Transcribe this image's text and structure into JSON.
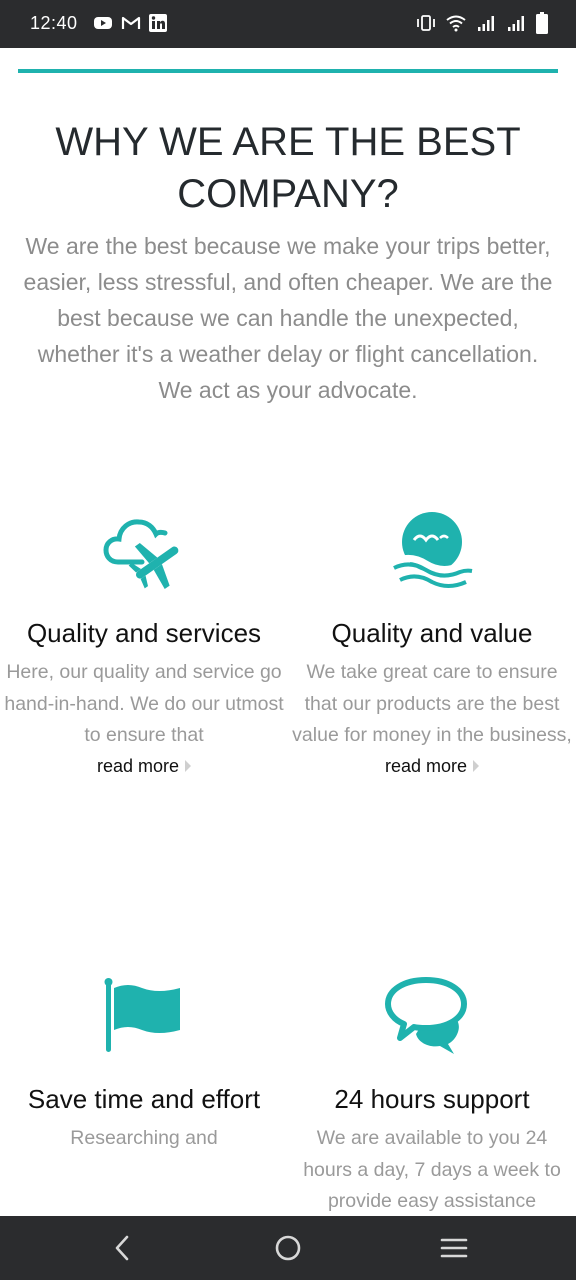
{
  "status": {
    "time": "12:40",
    "left_icons": [
      "youtube-icon",
      "gmail-icon",
      "linkedin-icon"
    ],
    "right_icons": [
      "vibrate-icon",
      "wifi-icon",
      "signal-icon",
      "signal-icon",
      "battery-icon"
    ]
  },
  "colors": {
    "accent": "#1fb2ae",
    "heading": "#252a2e",
    "body_text": "#8c8c8c",
    "system_bar": "#2b2c2e"
  },
  "page": {
    "heading": "WHY WE ARE THE BEST COMPANY?",
    "intro": "We are the best because we make your trips better, easier, less stressful, and often cheaper. We are the best because we can handle the unexpected, whether it's a weather delay or flight cancellation. We act as your advocate."
  },
  "features": [
    {
      "icon": "cloud-plane-icon",
      "title": "Quality and services",
      "desc": "Here, our quality and service go hand-in-hand. We do our utmost to ensure that",
      "read_more": "read more"
    },
    {
      "icon": "sun-waves-bird-icon",
      "title": "Quality and value",
      "desc": "We take great care to ensure that our products are the best value for money in the business,",
      "read_more": "read more"
    },
    {
      "icon": "flag-icon",
      "title": "Save time and effort",
      "desc": "Researching and"
    },
    {
      "icon": "chat-bubbles-icon",
      "title": "24 hours support",
      "desc": "We are available to you 24 hours a day, 7 days a week to provide easy assistance"
    }
  ],
  "nav": {
    "buttons": [
      "back-icon",
      "home-icon",
      "menu-icon"
    ]
  }
}
